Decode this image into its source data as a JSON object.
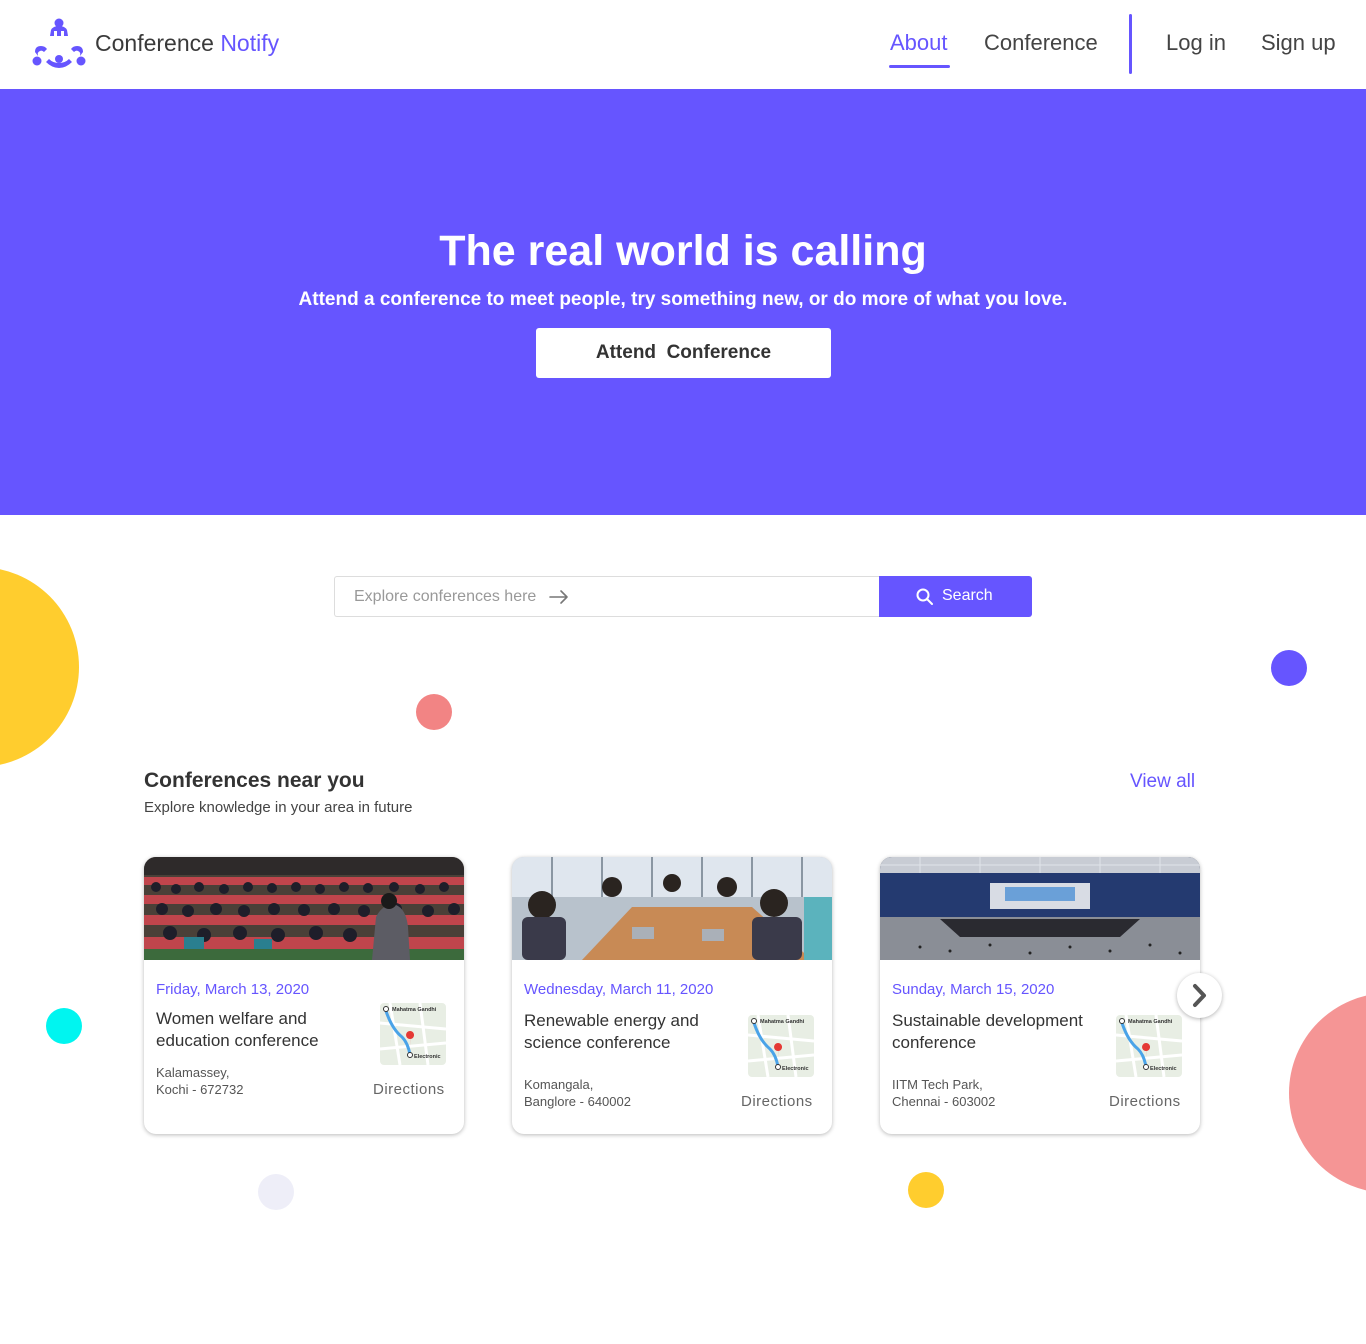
{
  "header": {
    "brand_part1": "Conference",
    "brand_part2": "Notify",
    "nav": {
      "about": "About",
      "conference": "Conference",
      "login": "Log in",
      "signup": "Sign up"
    }
  },
  "hero": {
    "title": "The real world is calling",
    "subtitle": "Attend a conference to meet people, try something new, or do more of what you love.",
    "cta": "Attend  Conference"
  },
  "search": {
    "placeholder": "Explore conferences here",
    "button": "Search"
  },
  "section": {
    "title": "Conferences near you",
    "subtitle": "Explore knowledge in your area in future",
    "view_all": "View all"
  },
  "cards": [
    {
      "date": "Friday, March 13, 2020",
      "title": "Women welfare and education conference",
      "address_line1": "Kalamassey,",
      "address_line2": "Kochi - 672732",
      "directions": "Directions",
      "map_label_top": "Mahatma Gandhi",
      "map_label_bottom": "Electronic"
    },
    {
      "date": "Wednesday, March 11, 2020",
      "title": "Renewable energy and science conference",
      "address_line1": "Komangala,",
      "address_line2": "Banglore - 640002",
      "directions": "Directions",
      "map_label_top": "Mahatma Gandhi",
      "map_label_bottom": "Electronic"
    },
    {
      "date": "Sunday, March 15, 2020",
      "title": "Sustainable development  conference",
      "address_line1": "IITM Tech Park,",
      "address_line2": "Chennai - 603002",
      "directions": "Directions",
      "map_label_top": "Mahatma Gandhi",
      "map_label_bottom": "Electronic"
    }
  ],
  "colors": {
    "primary": "#6655ff",
    "yellow": "#ffcd2e",
    "coral": "#f28484",
    "cyan": "#00f5f0"
  }
}
